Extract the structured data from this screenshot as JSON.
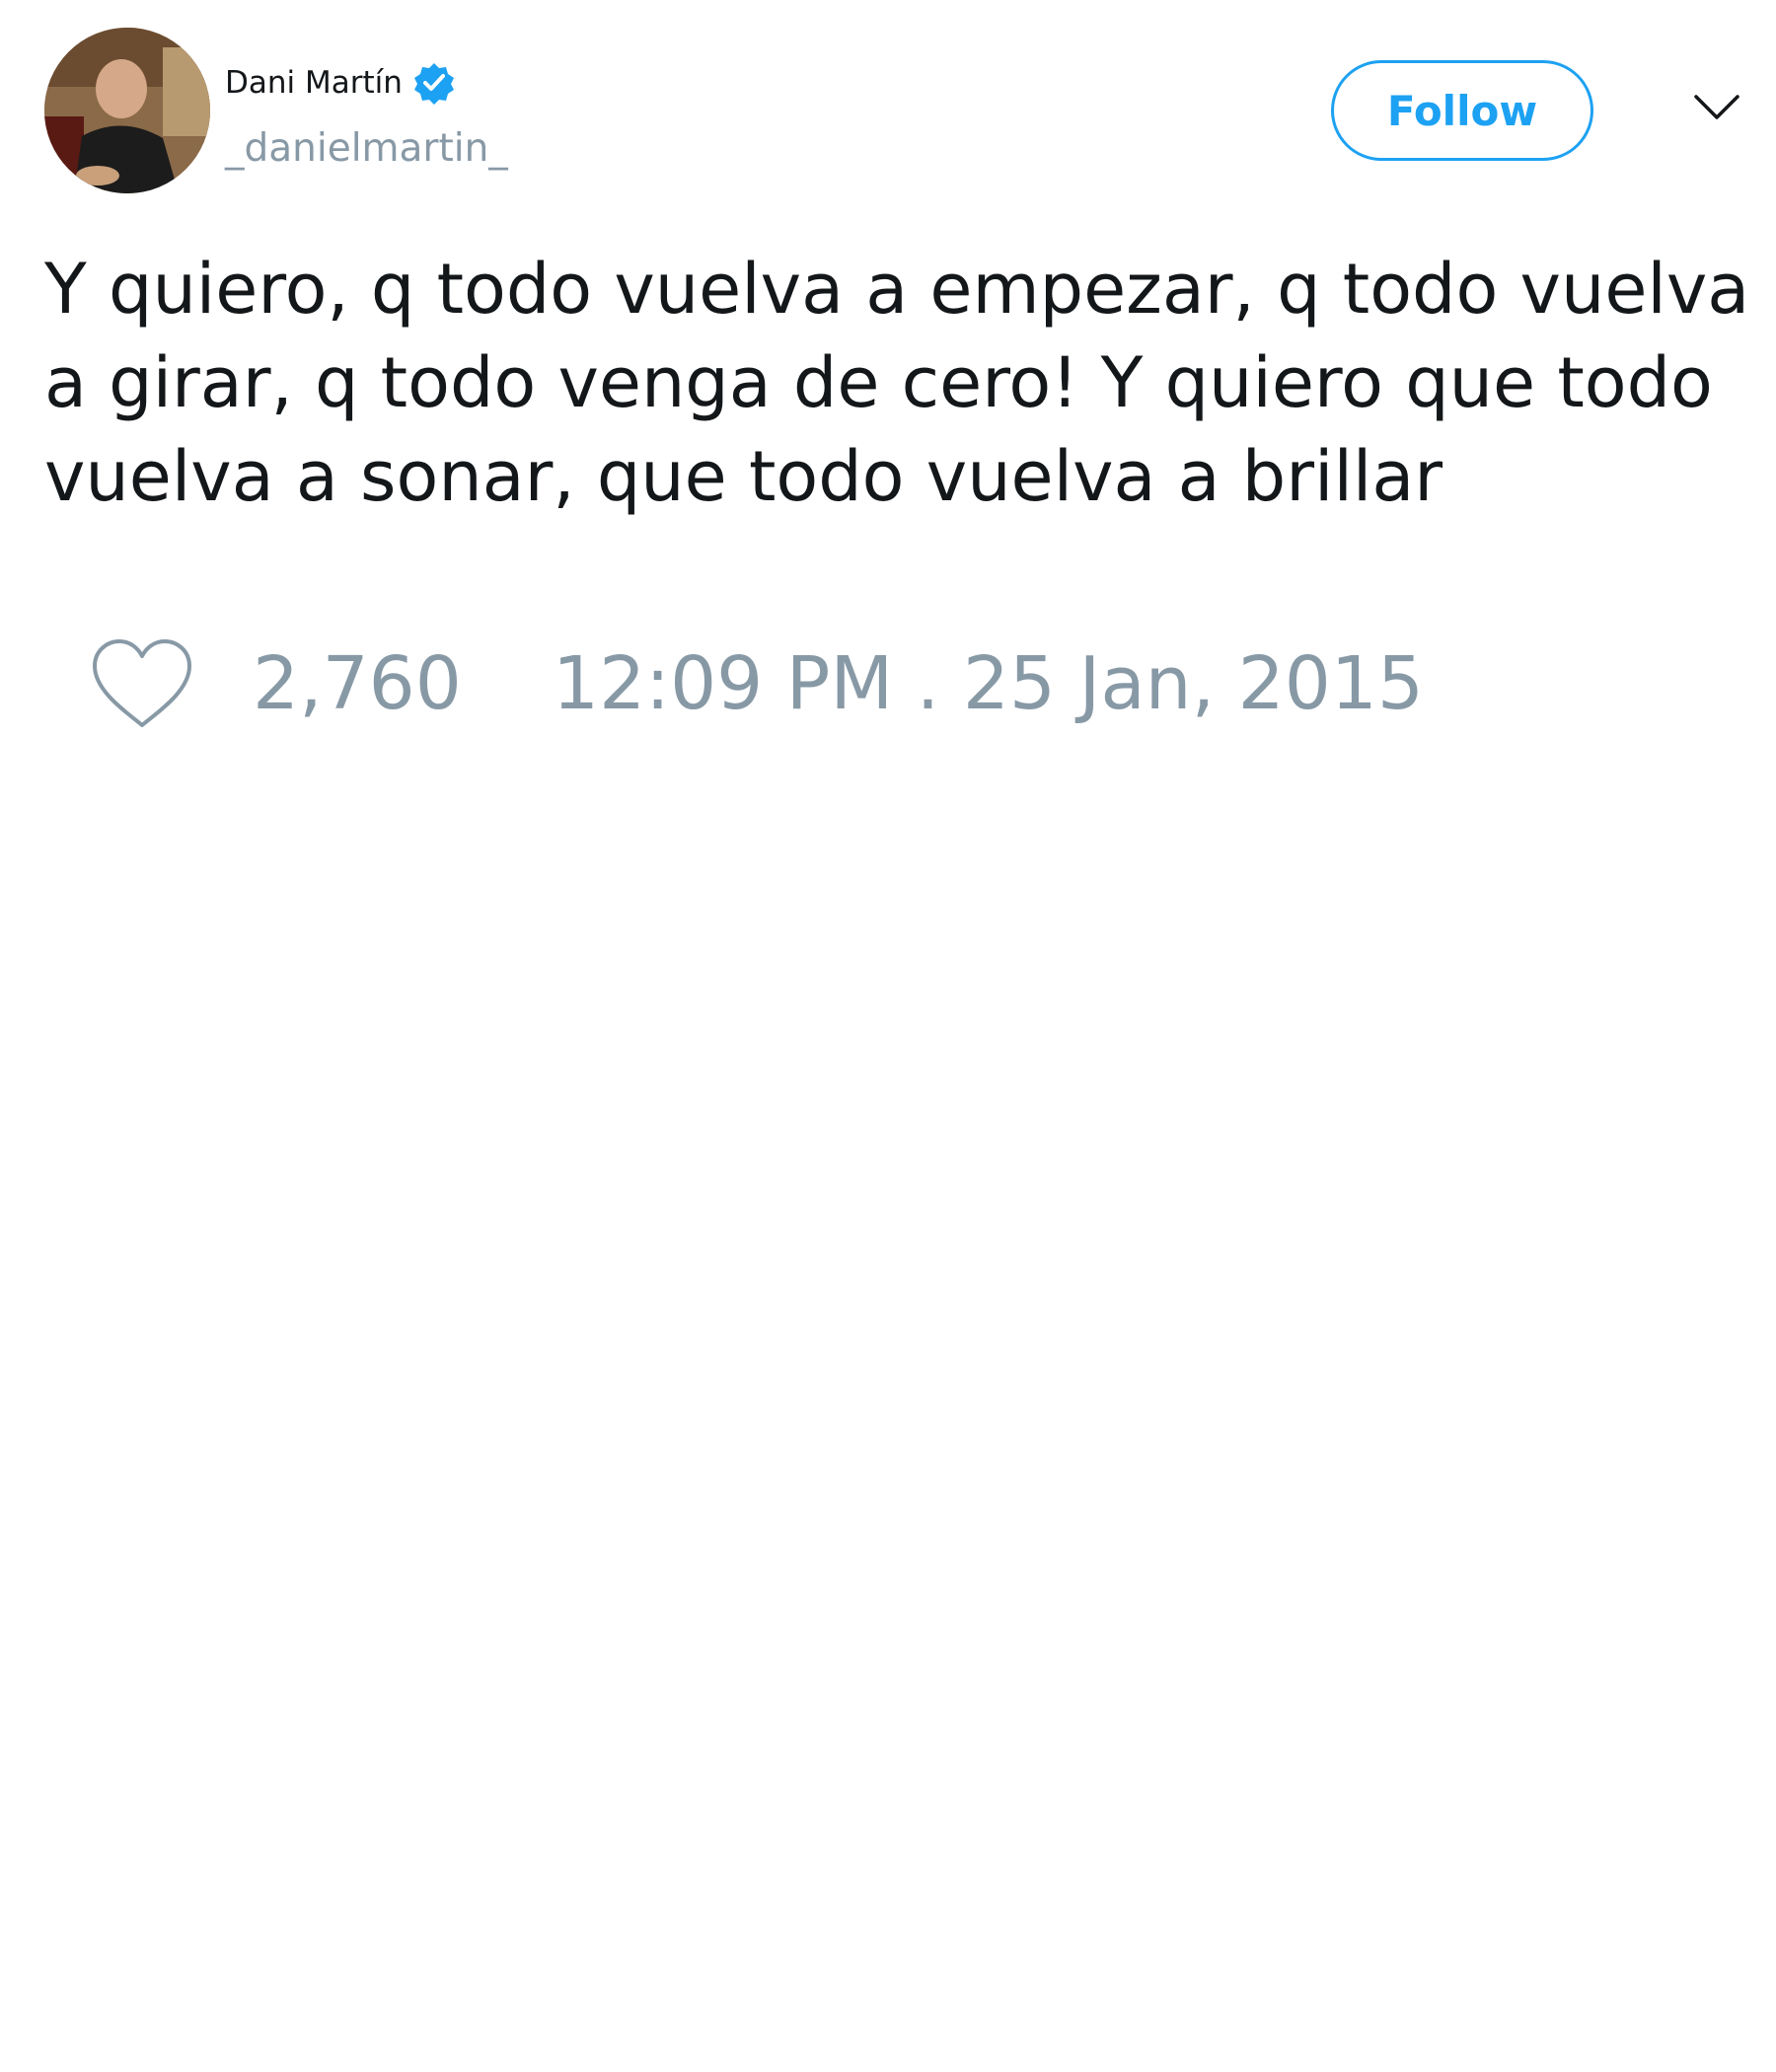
{
  "tweet": {
    "author": {
      "display_name": "Dani Martín",
      "handle": "_danielmartin_",
      "verified": true,
      "avatar_icon": "user-avatar"
    },
    "follow_label": "Follow",
    "menu_icon": "chevron-down-icon",
    "text": "Y quiero, q todo vuelva a empezar, q todo vuelva a girar, q todo venga de cero! Y quiero que todo vuelva a sonar, que todo vuelva a brillar",
    "likes": "2,760",
    "like_icon": "heart-icon",
    "timestamp": "12:09 PM . 25 Jan, 2015"
  },
  "colors": {
    "accent": "#1da1f2",
    "text": "#14171a",
    "muted": "#8899a6",
    "background": "#ffffff"
  }
}
